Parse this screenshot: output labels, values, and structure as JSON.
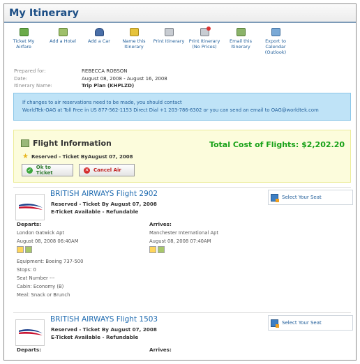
{
  "page": {
    "title": "My Itinerary"
  },
  "toolbar": [
    {
      "label": "Ticket My\nAirfare",
      "icon": "ticket-icon"
    },
    {
      "label": "Add a Hotel",
      "icon": "hotel-icon"
    },
    {
      "label": "Add a Car",
      "icon": "car-icon"
    },
    {
      "label": "Name this\nItinerary",
      "icon": "rename-icon"
    },
    {
      "label": "Print Itinerary",
      "icon": "printer-icon"
    },
    {
      "label": "Print Itinerary\n(No Prices)",
      "icon": "printer-no-prices-icon"
    },
    {
      "label": "Email this\nItinerary",
      "icon": "email-icon"
    },
    {
      "label": "Export to\nCalendar\n(Outlook)",
      "icon": "calendar-export-icon"
    }
  ],
  "info": {
    "prepared_for_label": "Prepared for:",
    "prepared_for": "REBECCA ROBSON",
    "date_label": "Date:",
    "date": "August 08, 2008 - August 16, 2008",
    "itinerary_name_label": "Itinerary Name:",
    "itinerary_name": "Trip Plan (KHPLZD)"
  },
  "notice": {
    "line1": "If changes to air reservations need to be made, you should contact",
    "line2": "WorldTek-OAG at Toll Free in US 877-562-1153 Direct Dial +1 203-786-6302 or you can send an email to OAG@worldtek.com"
  },
  "flight_info": {
    "title": "Flight Information",
    "total": "Total Cost of Flights: $2,202.20",
    "reserved": "Reserved - Ticket ByAugust 07, 2008",
    "ok_button": "Ok to Ticket",
    "cancel_button": "Cancel Air"
  },
  "flights": [
    {
      "title": "BRITISH AIRWAYS Flight 2902",
      "reserved": "Reserved - Ticket By August 07, 2008",
      "eticket": "E-Ticket Available - Refundable",
      "seat_link": "Select Your Seat",
      "departs_label": "Departs:",
      "departs_airport": "London Gatwick Apt",
      "departs_time": "August 08, 2008 06:40AM",
      "arrives_label": "Arrives:",
      "arrives_airport": "Manchester International Apt",
      "arrives_time": "August 08, 2008 07:40AM",
      "equipment": "Equipment: Boeing 737-500",
      "stops": "Stops: 0",
      "seat": "Seat Number ---",
      "cabin": "Cabin: Economy (B)",
      "meal": "Meal: Snack or Brunch"
    },
    {
      "title": "BRITISH AIRWAYS Flight 1503",
      "reserved": "Reserved - Ticket By August 07, 2008",
      "eticket": "E-Ticket Available - Refundable",
      "seat_link": "Select Your Seat",
      "departs_label": "Departs:",
      "arrives_label": "Arrives:"
    }
  ],
  "colors": {
    "title_blue": "#1d4f86",
    "link_blue": "#1f6bb0",
    "total_green": "#17a117",
    "notice_bg": "#bfe3f7",
    "flightinfo_bg": "#fcfcdc",
    "british_airways_red": "#c8102e",
    "british_airways_blue": "#1b3f8a"
  }
}
